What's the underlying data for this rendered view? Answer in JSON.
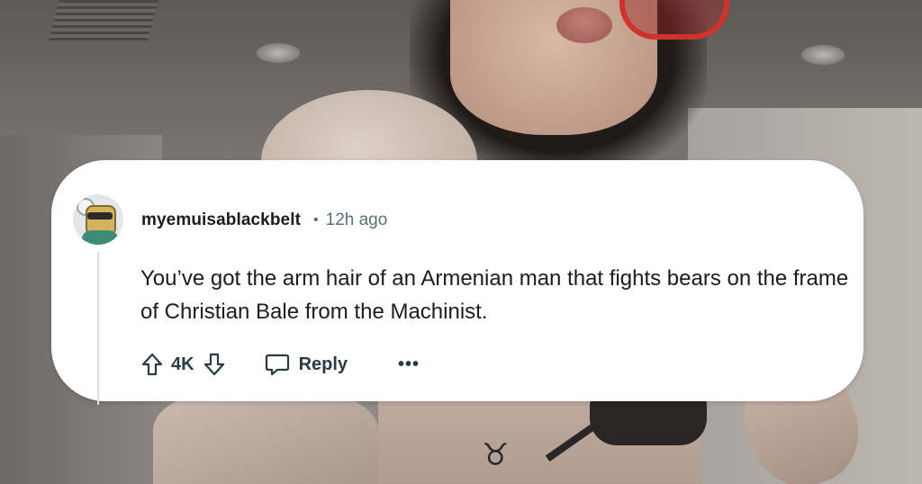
{
  "comment": {
    "username": "myemuisablackbelt",
    "separator": "•",
    "time": "12h ago",
    "text": "You’ve got the arm hair of an Armenian man that fights bears on the frame of Christian Bale from the Machinist.",
    "vote_count": "4K",
    "reply_label": "Reply",
    "more_label": "•••"
  },
  "photo": {
    "tattoo_glyph": "♉"
  },
  "icons": {
    "upvote": "upvote-icon",
    "downvote": "downvote-icon",
    "reply": "reply-icon",
    "avatar": "avatar"
  },
  "colors": {
    "card_bg": "#ffffff",
    "text_primary": "#1c1c1c",
    "text_meta": "#576f76",
    "action_text": "#2a3c42",
    "sunglasses": "#d0332c"
  }
}
